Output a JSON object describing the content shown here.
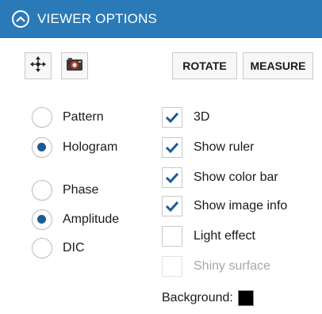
{
  "header": {
    "title": "VIEWER OPTIONS",
    "collapse_icon": "chevron-up-icon"
  },
  "toolbar": {
    "center_icon": "four-way-arrows-icon",
    "snapshot_icon": "camera-icon",
    "rotate_label": "ROTATE",
    "measure_label": "MEASURE"
  },
  "display_mode": {
    "options": [
      {
        "label": "Pattern",
        "checked": false
      },
      {
        "label": "Hologram",
        "checked": true
      }
    ]
  },
  "data_type": {
    "options": [
      {
        "label": "Phase",
        "checked": false
      },
      {
        "label": "Amplitude",
        "checked": true
      },
      {
        "label": "DIC",
        "checked": false
      }
    ]
  },
  "options": {
    "items": [
      {
        "label": "3D",
        "checked": true,
        "enabled": true
      },
      {
        "label": "Show ruler",
        "checked": true,
        "enabled": true
      },
      {
        "label": "Show color bar",
        "checked": true,
        "enabled": true
      },
      {
        "label": "Show image info",
        "checked": true,
        "enabled": true
      },
      {
        "label": "Light effect",
        "checked": false,
        "enabled": true
      },
      {
        "label": "Shiny surface",
        "checked": false,
        "enabled": false
      }
    ]
  },
  "background": {
    "label": "Background:",
    "color": "#000000"
  },
  "colors": {
    "header": "#2b7ab8",
    "accent": "#1e5a96"
  }
}
